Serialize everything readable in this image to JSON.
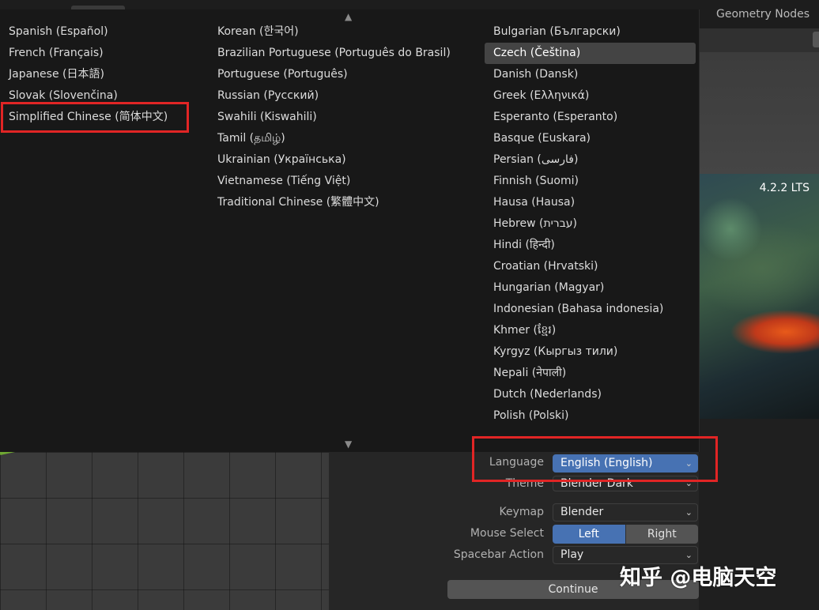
{
  "header": {
    "workspace_tab": "Geometry Nodes"
  },
  "splash": {
    "version": "4.2.2 LTS"
  },
  "language_menu": {
    "scroll_up_icon": "▲",
    "scroll_down_icon": "▼",
    "columns": [
      [
        "Spanish (Español)",
        "French (Français)",
        "Japanese (日本語)",
        "Slovak (Slovenčina)",
        "Simplified Chinese (简体中文)"
      ],
      [
        "Korean (한국어)",
        "Brazilian Portuguese (Português do Brasil)",
        "Portuguese (Português)",
        "Russian (Русский)",
        "Swahili (Kiswahili)",
        "Tamil (தமிழ்)",
        "Ukrainian (Українська)",
        "Vietnamese (Tiếng Việt)",
        "Traditional Chinese (繁體中文)"
      ],
      [
        "Bulgarian (Български)",
        "Czech (Čeština)",
        "Danish (Dansk)",
        "Greek (Ελληνικά)",
        "Esperanto (Esperanto)",
        "Basque (Euskara)",
        "Persian (فارسی)",
        "Finnish (Suomi)",
        "Hausa (Hausa)",
        "Hebrew (עברית)",
        "Hindi (हिन्दी)",
        "Croatian (Hrvatski)",
        "Hungarian (Magyar)",
        "Indonesian (Bahasa indonesia)",
        "Khmer (ខ្មែរ)",
        "Kyrgyz (Кыргыз тили)",
        "Nepali (नेपाली)",
        "Dutch (Nederlands)",
        "Polish (Polski)"
      ]
    ],
    "highlighted_item": "Czech (Čeština)"
  },
  "settings": {
    "language_label": "Language",
    "language_value": "English (English)",
    "theme_label": "Theme",
    "theme_value": "Blender Dark",
    "keymap_label": "Keymap",
    "keymap_value": "Blender",
    "mouse_select_label": "Mouse Select",
    "mouse_select_left": "Left",
    "mouse_select_right": "Right",
    "spacebar_label": "Spacebar Action",
    "spacebar_value": "Play",
    "continue_label": "Continue",
    "chevron_icon": "⌄"
  },
  "watermark": "知乎 @电脑天空",
  "colors": {
    "accent_blue": "#4772b3",
    "highlight_red": "#e12525",
    "menu_bg": "#181818"
  }
}
